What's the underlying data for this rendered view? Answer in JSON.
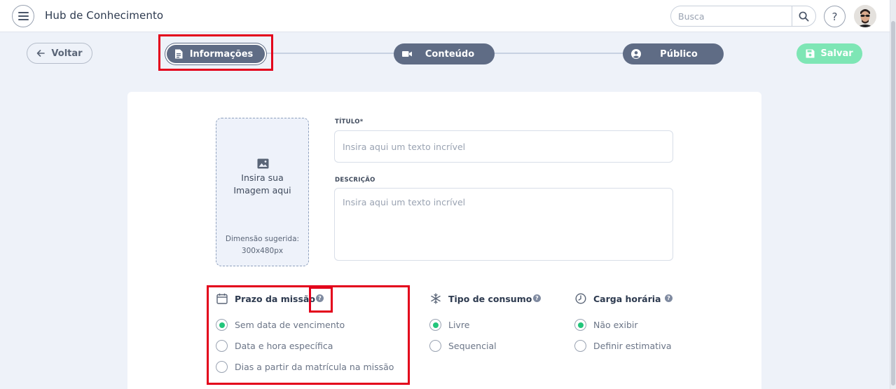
{
  "header": {
    "app_title": "Hub de Conhecimento",
    "search_placeholder": "Busca",
    "help_label": "?"
  },
  "toolbar": {
    "back_label": "Voltar",
    "save_label": "Salvar",
    "steps": [
      {
        "label": "Informações",
        "icon": "document-icon",
        "active": true
      },
      {
        "label": "Conteúdo",
        "icon": "video-camera-icon",
        "active": false
      },
      {
        "label": "Público",
        "icon": "user-circle-icon",
        "active": false
      }
    ]
  },
  "form": {
    "image_upload": {
      "prompt": "Insira sua Imagem aqui",
      "prompt_line1": "Insira sua",
      "prompt_line2": "Imagem aqui",
      "hint_line1": "Dimensão sugerida:",
      "hint_line2": "300x480px"
    },
    "title_label": "TÍTULO*",
    "title_placeholder": "Insira aqui um texto incrível",
    "description_label": "DESCRIÇÃO",
    "description_placeholder": "Insira aqui um texto incrível"
  },
  "sections": {
    "deadline": {
      "title": "Prazo da missão",
      "options": [
        "Sem data de vencimento",
        "Data e hora específica",
        "Dias a partir da matrícula na missão"
      ],
      "selected": 0
    },
    "consumption": {
      "title": "Tipo de consumo",
      "options": [
        "Livre",
        "Sequencial"
      ],
      "selected": 0
    },
    "workload": {
      "title": "Carga horária",
      "options": [
        "Não exibir",
        "Definir estimativa"
      ],
      "selected": 0
    }
  },
  "colors": {
    "step_bg": "#5f6c85",
    "save_bg": "#7ee6b5",
    "radio_selected": "#22c57b",
    "highlight": "#e3001b",
    "page_bg": "#eef2f9"
  }
}
